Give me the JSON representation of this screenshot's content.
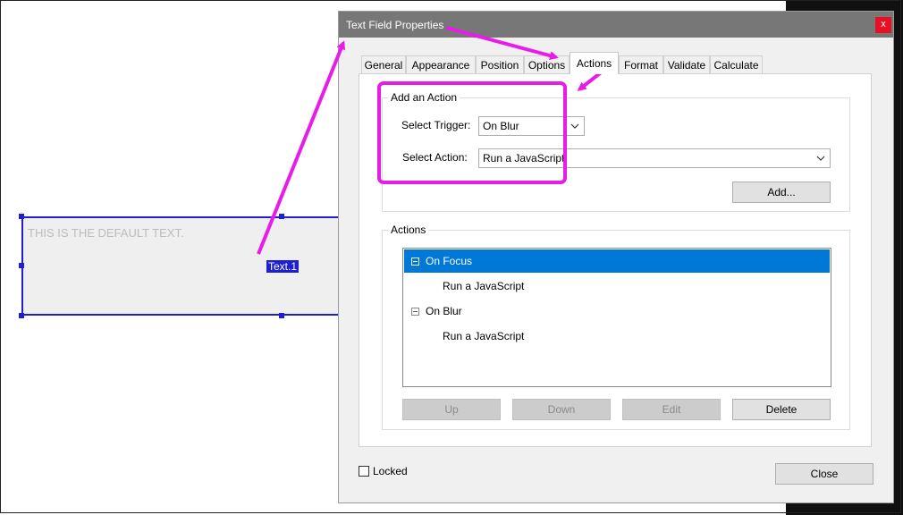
{
  "page_field": {
    "default_text": "THIS IS THE DEFAULT TEXT.",
    "field_name": "Text.1"
  },
  "dialog": {
    "title": "Text Field Properties",
    "close_glyph": "x",
    "tabs": [
      {
        "label": "General"
      },
      {
        "label": "Appearance"
      },
      {
        "label": "Position"
      },
      {
        "label": "Options"
      },
      {
        "label": "Actions"
      },
      {
        "label": "Format"
      },
      {
        "label": "Validate"
      },
      {
        "label": "Calculate"
      }
    ],
    "active_tab": "Actions",
    "add_action": {
      "legend": "Add an Action",
      "trigger_label": "Select Trigger:",
      "trigger_value": "On Blur",
      "action_label": "Select Action:",
      "action_value": "Run a JavaScript",
      "add_button": "Add..."
    },
    "actions": {
      "legend": "Actions",
      "items": [
        {
          "label": "On Focus",
          "selected": true
        },
        {
          "label": "Run a JavaScript"
        },
        {
          "label": "On Blur"
        },
        {
          "label": "Run a JavaScript"
        }
      ],
      "buttons": {
        "up": "Up",
        "down": "Down",
        "edit": "Edit",
        "delete": "Delete"
      }
    },
    "locked_label": "Locked",
    "close_button": "Close"
  },
  "colors": {
    "annotation": "#e81ce8",
    "selection": "#0078d7",
    "field_border": "#1f1fd0"
  }
}
